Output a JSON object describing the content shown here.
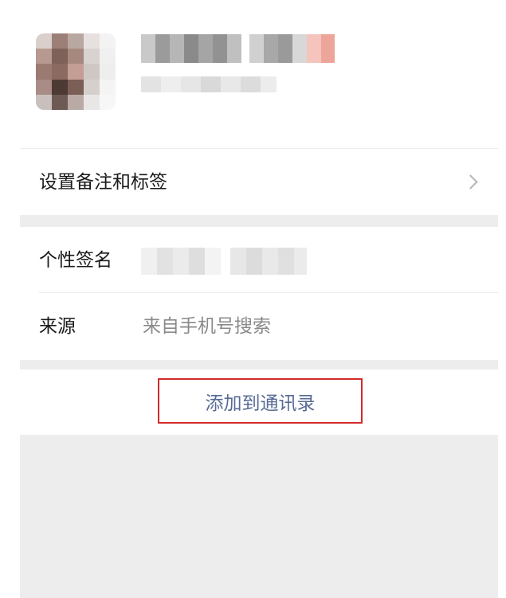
{
  "profile": {
    "avatar_icon": "avatar-pixelated",
    "name_hidden": true,
    "id_hidden": true
  },
  "rows": {
    "remark_tags_label": "设置备注和标签",
    "signature_label": "个性签名",
    "source_label": "来源",
    "source_value": "来自手机号搜索"
  },
  "actions": {
    "add_contact_label": "添加到通讯录"
  },
  "colors": {
    "link_blue": "#576b95",
    "highlight_red": "#d42a2a",
    "gap_gray": "#ededed"
  }
}
